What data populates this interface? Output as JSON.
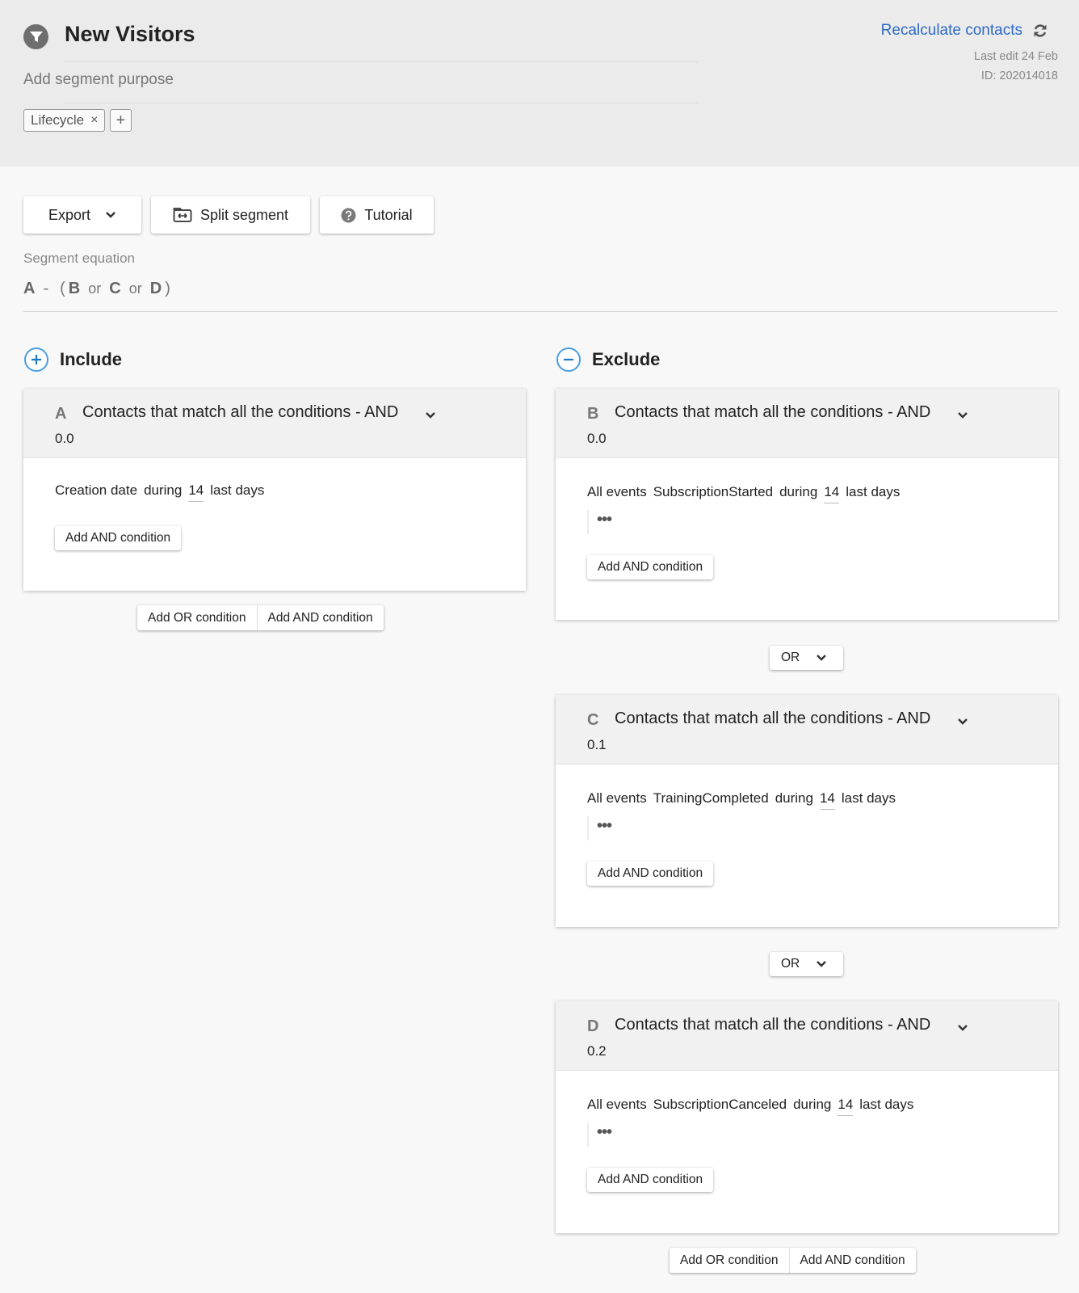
{
  "header": {
    "title": "New Visitors",
    "purpose_placeholder": "Add segment purpose",
    "tag": "Lifecycle",
    "tag_remove": "×",
    "tag_add": "+",
    "recalculate": "Recalculate contacts",
    "last_edit": "Last edit 24 Feb",
    "id": "ID:  202014018"
  },
  "toolbar": {
    "export": "Export",
    "split": "Split segment",
    "tutorial": "Tutorial"
  },
  "equation": {
    "label": "Segment equation",
    "a": "A",
    "minus": "-",
    "open": "(",
    "b": "B",
    "or1": "or",
    "c": "C",
    "or2": "or",
    "d": "D",
    "close": ")"
  },
  "include": {
    "title": "Include",
    "card": {
      "letter": "A",
      "heading": "Contacts that match all the conditions - AND",
      "score": "0.0",
      "condition": {
        "field": "Creation date",
        "op": "during",
        "num": "14",
        "unit": "last days"
      },
      "add_and": "Add AND condition"
    },
    "add_or": "Add OR condition",
    "add_and": "Add AND condition"
  },
  "exclude": {
    "title": "Exclude",
    "cards": [
      {
        "letter": "B",
        "heading": "Contacts that match all the conditions - AND",
        "score": "0.0",
        "condition": {
          "field": "All events",
          "event": "SubscriptionStarted",
          "op": "during",
          "num": "14",
          "unit": "last days"
        },
        "more": "•••",
        "add_and": "Add AND condition"
      },
      {
        "letter": "C",
        "heading": "Contacts that match all the conditions - AND",
        "score": "0.1",
        "condition": {
          "field": "All events",
          "event": "TrainingCompleted",
          "op": "during",
          "num": "14",
          "unit": "last days"
        },
        "more": "•••",
        "add_and": "Add AND condition"
      },
      {
        "letter": "D",
        "heading": "Contacts that match all the conditions - AND",
        "score": "0.2",
        "condition": {
          "field": "All events",
          "event": "SubscriptionCanceled",
          "op": "during",
          "num": "14",
          "unit": "last days"
        },
        "more": "•••",
        "add_and": "Add AND condition"
      }
    ],
    "or_select": [
      "OR",
      "OR"
    ],
    "add_or": "Add OR condition",
    "add_and": "Add AND condition"
  },
  "colors": {
    "accent": "#2e6bc6",
    "section_icon": "#4a9ee0",
    "header_bg": "#ebebeb"
  }
}
